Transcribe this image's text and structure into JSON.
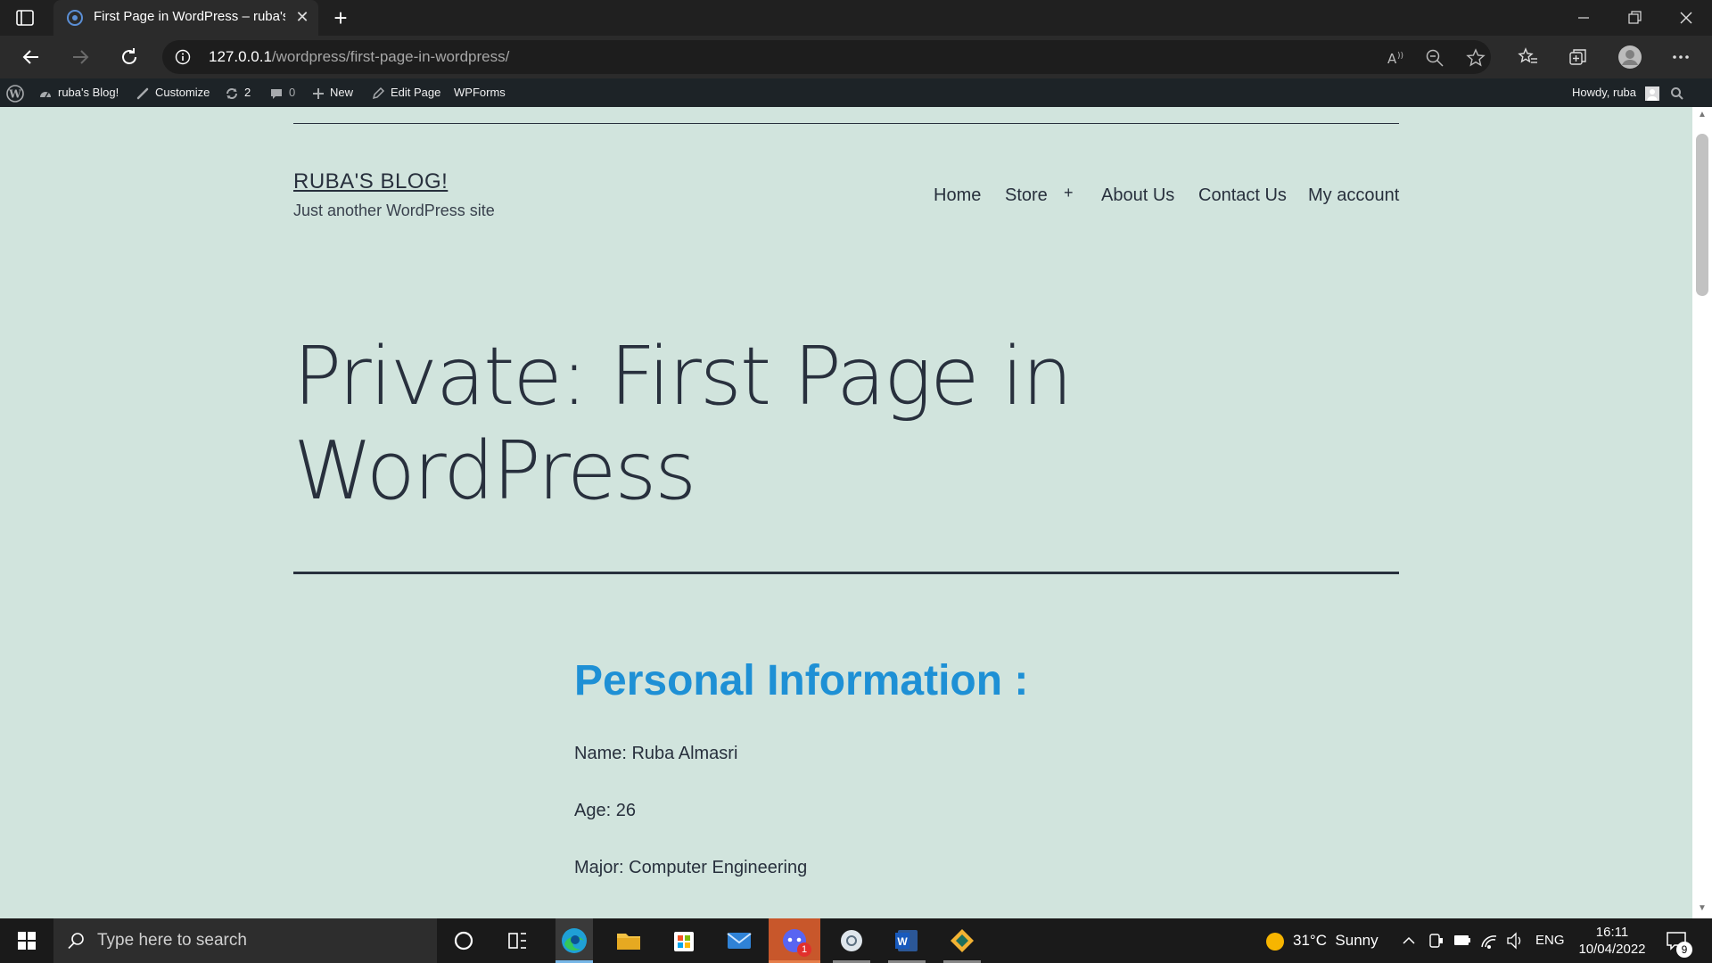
{
  "browser": {
    "tab_title": "First Page in WordPress – ruba's",
    "url_host": "127.0.0.1",
    "url_path": "/wordpress/first-page-in-wordpress/"
  },
  "adminbar": {
    "site_name": "ruba's Blog!",
    "customize": "Customize",
    "updates_count": "2",
    "comments_count": "0",
    "new": "New",
    "edit_page": "Edit Page",
    "wpforms": "WPForms",
    "howdy": "Howdy, ruba"
  },
  "site": {
    "title": "RUBA'S BLOG!",
    "tagline": "Just another WordPress site",
    "menu": {
      "home": "Home",
      "store": "Store",
      "submenu_toggle": "+",
      "about": "About Us",
      "contact": "Contact Us",
      "account": "My account"
    }
  },
  "content": {
    "page_title": "Private: First Page in WordPress",
    "heading": "Personal Information :",
    "lines": [
      "Name: Ruba Almasri",
      "Age: 26",
      "Major: Computer Engineering"
    ]
  },
  "taskbar": {
    "search_placeholder": "Type here to search",
    "weather": "31°C  Sunny",
    "language": "ENG",
    "time": "16:11",
    "date": "10/04/2022",
    "notifications": "9",
    "discord_badge": "1"
  }
}
